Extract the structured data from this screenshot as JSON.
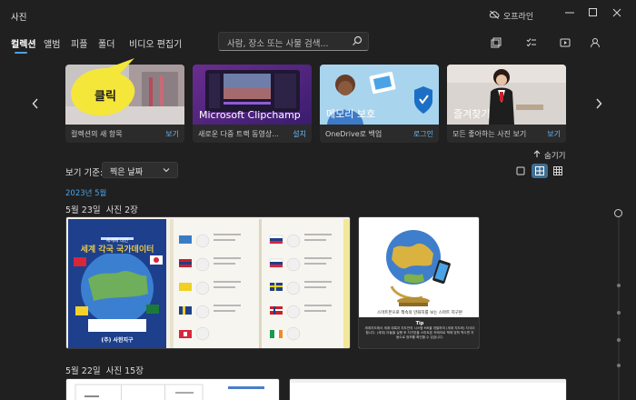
{
  "app": {
    "title": "사진",
    "offline_label": "오프라인"
  },
  "nav": {
    "tabs": [
      {
        "label": "컬렉션",
        "active": true
      },
      {
        "label": "앨범",
        "active": false
      },
      {
        "label": "피플",
        "active": false
      },
      {
        "label": "폴더",
        "active": false
      },
      {
        "label": "비디오 편집기",
        "active": false
      }
    ],
    "search_placeholder": "사람, 장소 또는 사물 검색..."
  },
  "toolbar_icons": [
    "import-icon",
    "select-icon",
    "slideshow-icon",
    "account-icon"
  ],
  "callout": {
    "text": "클릭",
    "color": "#f5e63a"
  },
  "carousel": [
    {
      "img_label": "",
      "description": "컬렉션의 새 항목",
      "action": "보기"
    },
    {
      "img_label": "Microsoft Clipchamp",
      "description": "새로운 다중 트랙 동영상...",
      "action": "설치"
    },
    {
      "img_label": "메모리 보호",
      "description": "OneDrive로 백업",
      "action": "로그인"
    },
    {
      "img_label": "즐겨찾기",
      "description": "모든 좋아하는 사진 보기",
      "action": "보기"
    }
  ],
  "collapse_label": "숨기기",
  "sort": {
    "label": "보기 기준:",
    "value": "찍은 날짜"
  },
  "view_modes": [
    {
      "name": "single-view-icon",
      "active": false
    },
    {
      "name": "grid-view-icon",
      "active": true
    },
    {
      "name": "dense-view-icon",
      "active": false
    }
  ],
  "timeline": {
    "month": "2023년 5월",
    "groups": [
      {
        "date": "5월 23일",
        "count": "사진 2장"
      },
      {
        "date": "5월 22일",
        "count": "사진 15장"
      }
    ]
  },
  "photos": {
    "atlas_cover_title": "세계 각국 국가데이터",
    "atlas_cover_subtitle": "세계에 대한",
    "atlas_publisher": "(주) 사한지구",
    "globe_tip_label": "Tip",
    "globe_caption": "스마트폰으로 책속의 만화지를 보는 스마트 지구본",
    "globe_body": "세계지도에서 세계 대륙과 지도안의 시스템 MR을 개발하여 (세계 지도와) 지식이 합니다. (세계) 아들을 실행 후 지구본을 스마트폰 카메라로 책에 맞춰 찍으면 자동으로 정보를 확인할 수 있습니다."
  }
}
